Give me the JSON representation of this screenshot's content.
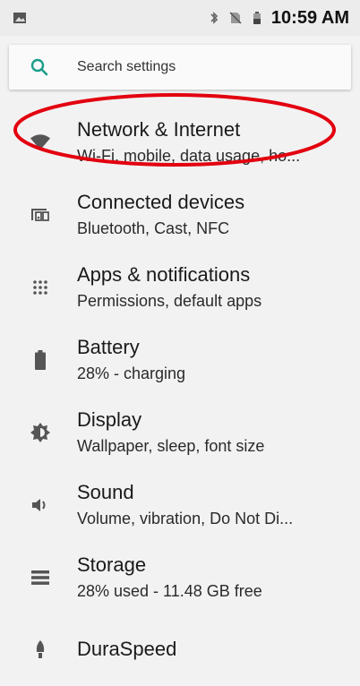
{
  "status_bar": {
    "time": "10:59 AM",
    "icons": [
      "image-icon",
      "bluetooth-icon",
      "no-sim-icon",
      "battery-charging-icon"
    ]
  },
  "search": {
    "label": "Search settings"
  },
  "settings": [
    {
      "title": "Network & Internet",
      "subtitle": "Wi-Fi, mobile, data usage, ho...",
      "icon": "wifi-icon"
    },
    {
      "title": "Connected devices",
      "subtitle": "Bluetooth, Cast, NFC",
      "icon": "connected-devices-icon"
    },
    {
      "title": "Apps & notifications",
      "subtitle": "Permissions, default apps",
      "icon": "apps-grid-icon"
    },
    {
      "title": "Battery",
      "subtitle": "28% - charging",
      "icon": "battery-icon"
    },
    {
      "title": "Display",
      "subtitle": "Wallpaper, sleep, font size",
      "icon": "brightness-icon"
    },
    {
      "title": "Sound",
      "subtitle": "Volume, vibration, Do Not Di...",
      "icon": "volume-icon"
    },
    {
      "title": "Storage",
      "subtitle": "28% used - 11.48 GB free",
      "icon": "storage-icon"
    },
    {
      "title": "DuraSpeed",
      "subtitle": "",
      "icon": "rocket-icon"
    }
  ],
  "annotation": {
    "color": "#e3000f",
    "target": "Network & Internet"
  }
}
